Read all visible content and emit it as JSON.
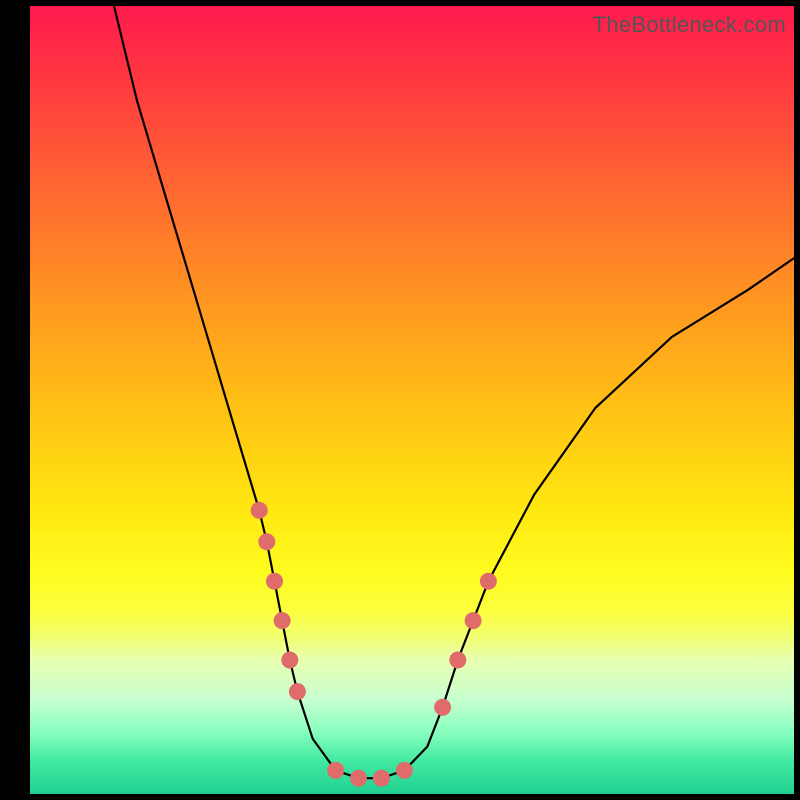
{
  "watermark": "TheBottleneck.com",
  "chart_data": {
    "type": "line",
    "title": "",
    "xlabel": "",
    "ylabel": "",
    "xlim": [
      0,
      100
    ],
    "ylim": [
      0,
      100
    ],
    "series": [
      {
        "name": "bottleneck-curve",
        "type": "line",
        "x": [
          11,
          14,
          18,
          22,
          26,
          30,
          31,
          32,
          33,
          34,
          35,
          37,
          40,
          43,
          46,
          49,
          52,
          54,
          56,
          58,
          60,
          66,
          74,
          84,
          94,
          100
        ],
        "values": [
          100,
          88,
          75,
          62,
          49,
          36,
          32,
          27,
          22,
          17,
          13,
          7,
          3,
          2,
          2,
          3,
          6,
          11,
          17,
          22,
          27,
          38,
          49,
          58,
          64,
          68
        ]
      },
      {
        "name": "marker-dots",
        "type": "scatter",
        "x": [
          30,
          31,
          32,
          33,
          34,
          35,
          40,
          43,
          46,
          49,
          54,
          56,
          58,
          60
        ],
        "values": [
          36,
          32,
          27,
          22,
          17,
          13,
          3,
          2,
          2,
          3,
          11,
          17,
          22,
          27
        ]
      }
    ],
    "colors": {
      "curve": "#000000",
      "dots": "#e06b6b",
      "gradient_top": "#ff1a4d",
      "gradient_bottom": "#20d090"
    }
  }
}
